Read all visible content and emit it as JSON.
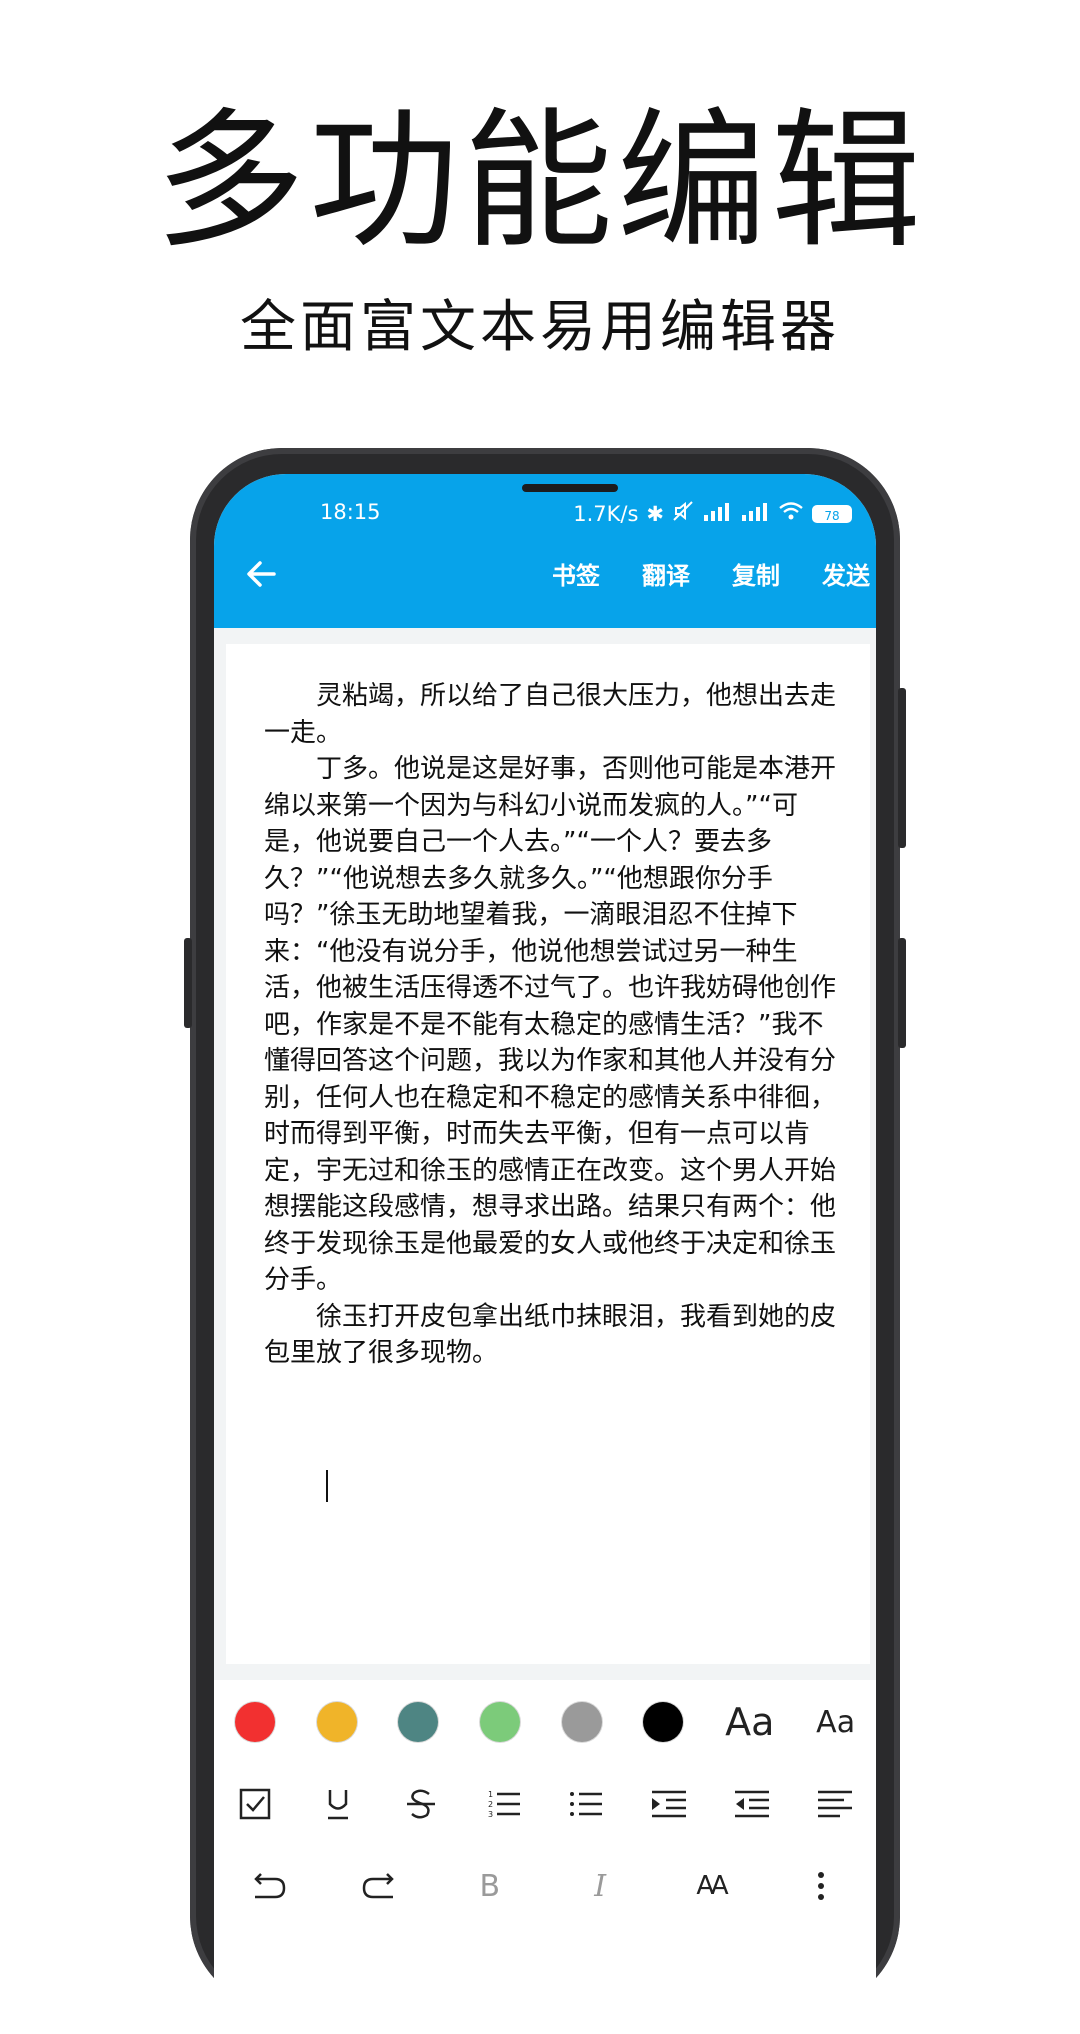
{
  "promo": {
    "title": "多功能编辑",
    "subtitle": "全面富文本易用编辑器"
  },
  "status_bar": {
    "time": "18:15",
    "network_speed": "1.7K/s",
    "battery": "78"
  },
  "app_bar": {
    "back_icon": "arrow-left-icon",
    "actions": {
      "bookmark": "书签",
      "translate": "翻译",
      "copy": "复制",
      "send": "发送"
    }
  },
  "editor": {
    "paragraphs": [
      "灵粘竭，所以给了自己很大压力，他想出去走一走。",
      "丁多。他说是这是好事，否则他可能是本港开绵以来第一个因为与科幻小说而发疯的人。”“可是，他说要自己一个人去。”“一个人？要去多久？”“他说想去多久就多久。”“他想跟你分手吗？”徐玉无助地望着我，一滴眼泪忍不住掉下来：“他没有说分手，他说他想尝试过另一种生活，他被生活压得透不过气了。也许我妨碍他创作吧，作家是不是不能有太稳定的感情生活？”我不懂得回答这个问题，我以为作家和其他人并没有分别，任何人也在稳定和不稳定的感情关系中徘徊，时而得到平衡，时而失去平衡，但有一点可以肯定，宇无过和徐玉的感情正在改变。这个男人开始想摆能这段感情，想寻求出路。结果只有两个：他终于发现徐玉是他最爱的女人或他终于决定和徐玉分手。",
      "徐玉打开皮包拿出纸巾抹眼泪，我看到她的皮包里放了很多现物。"
    ]
  },
  "format_panel": {
    "colors": [
      "#f23030",
      "#f0b429",
      "#4e8583",
      "#7ccb7a",
      "#9a9a9a",
      "#000000"
    ],
    "font_size_large": "Aa",
    "font_size_small": "Aa",
    "row2_icons": [
      "checkbox-icon",
      "underline-icon",
      "strikethrough-icon",
      "ordered-list-icon",
      "bullet-list-icon",
      "indent-icon",
      "outdent-icon",
      "align-left-icon"
    ],
    "row3_icons": [
      "undo-icon",
      "redo-icon",
      "bold-icon",
      "italic-icon",
      "font-style-icon",
      "more-icon"
    ],
    "bold_label": "B",
    "italic_label": "I",
    "font_style_label": "AA"
  }
}
